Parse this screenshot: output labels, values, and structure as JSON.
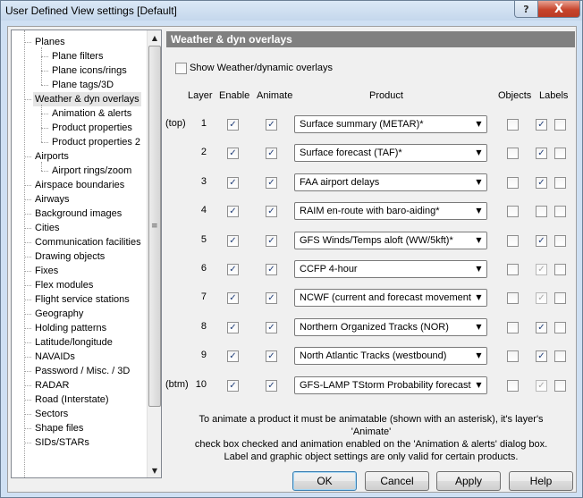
{
  "window": {
    "title": "User Defined View settings  [Default]",
    "help_glyph": "?",
    "close_glyph": "X"
  },
  "tree": {
    "items": [
      {
        "label": "Planes",
        "level": 0
      },
      {
        "label": "Plane filters",
        "level": 1
      },
      {
        "label": "Plane icons/rings",
        "level": 1
      },
      {
        "label": "Plane tags/3D",
        "level": 1
      },
      {
        "label": "Weather & dyn overlays",
        "level": 0,
        "selected": true
      },
      {
        "label": "Animation & alerts",
        "level": 1
      },
      {
        "label": "Product properties",
        "level": 1
      },
      {
        "label": "Product properties 2",
        "level": 1
      },
      {
        "label": "Airports",
        "level": 0
      },
      {
        "label": "Airport rings/zoom",
        "level": 1
      },
      {
        "label": "Airspace boundaries",
        "level": 0
      },
      {
        "label": "Airways",
        "level": 0
      },
      {
        "label": "Background images",
        "level": 0
      },
      {
        "label": "Cities",
        "level": 0
      },
      {
        "label": "Communication facilities",
        "level": 0
      },
      {
        "label": "Drawing objects",
        "level": 0
      },
      {
        "label": "Fixes",
        "level": 0
      },
      {
        "label": "Flex modules",
        "level": 0
      },
      {
        "label": "Flight service stations",
        "level": 0
      },
      {
        "label": "Geography",
        "level": 0
      },
      {
        "label": "Holding patterns",
        "level": 0
      },
      {
        "label": "Latitude/longitude",
        "level": 0
      },
      {
        "label": "NAVAIDs",
        "level": 0
      },
      {
        "label": "Password / Misc. / 3D",
        "level": 0
      },
      {
        "label": "RADAR",
        "level": 0
      },
      {
        "label": "Road (Interstate)",
        "level": 0
      },
      {
        "label": "Sectors",
        "level": 0
      },
      {
        "label": "Shape files",
        "level": 0
      },
      {
        "label": "SIDs/STARs",
        "level": 0
      }
    ],
    "scroll_up": "▲",
    "scroll_down": "▼",
    "grip": "≡"
  },
  "panel": {
    "header": "Weather & dyn overlays",
    "show_overlays_label": "Show Weather/dynamic overlays",
    "show_overlays_checked": false,
    "columns": {
      "layer": "Layer",
      "enable": "Enable",
      "animate": "Animate",
      "product": "Product",
      "objects": "Objects",
      "labels": "Labels"
    },
    "check_glyph": "✓",
    "dropdown_glyph": "▼",
    "rows": [
      {
        "tag": "(top)",
        "layer": "1",
        "enable": true,
        "animate": true,
        "product": "Surface summary (METAR)*",
        "objects": false,
        "labels": true,
        "labels_disabled": false,
        "extra": false
      },
      {
        "tag": "",
        "layer": "2",
        "enable": true,
        "animate": true,
        "product": "Surface forecast (TAF)*",
        "objects": false,
        "labels": true,
        "labels_disabled": false,
        "extra": false
      },
      {
        "tag": "",
        "layer": "3",
        "enable": true,
        "animate": true,
        "product": "FAA airport delays",
        "objects": false,
        "labels": true,
        "labels_disabled": false,
        "extra": false
      },
      {
        "tag": "",
        "layer": "4",
        "enable": true,
        "animate": true,
        "product": "RAIM en-route with baro-aiding*",
        "objects": false,
        "labels": false,
        "labels_disabled": false,
        "extra": false
      },
      {
        "tag": "",
        "layer": "5",
        "enable": true,
        "animate": true,
        "product": "GFS Winds/Temps aloft (WW/5kft)*",
        "objects": false,
        "labels": true,
        "labels_disabled": false,
        "extra": false
      },
      {
        "tag": "",
        "layer": "6",
        "enable": true,
        "animate": true,
        "product": "CCFP 4-hour",
        "objects": false,
        "labels": true,
        "labels_disabled": true,
        "extra": false
      },
      {
        "tag": "",
        "layer": "7",
        "enable": true,
        "animate": true,
        "product": "NCWF (current and forecast movement)*",
        "objects": false,
        "labels": true,
        "labels_disabled": true,
        "extra": false
      },
      {
        "tag": "",
        "layer": "8",
        "enable": true,
        "animate": true,
        "product": "Northern Organized Tracks (NOR)",
        "objects": false,
        "labels": true,
        "labels_disabled": false,
        "extra": false
      },
      {
        "tag": "",
        "layer": "9",
        "enable": true,
        "animate": true,
        "product": "North Atlantic Tracks (westbound)",
        "objects": false,
        "labels": true,
        "labels_disabled": false,
        "extra": false
      },
      {
        "tag": "(btm)",
        "layer": "10",
        "enable": true,
        "animate": true,
        "product": "GFS-LAMP TStorm Probability forecast*",
        "objects": false,
        "labels": true,
        "labels_disabled": true,
        "extra": false
      }
    ],
    "note_line1": "To animate a product it must be animatable (shown with an asterisk), it's layer's 'Animate'",
    "note_line2": "check box checked and animation enabled on the 'Animation & alerts' dialog box.",
    "note_line3": "Label and graphic object settings are only valid for certain products."
  },
  "buttons": {
    "ok": "OK",
    "cancel": "Cancel",
    "apply": "Apply",
    "help": "Help"
  }
}
